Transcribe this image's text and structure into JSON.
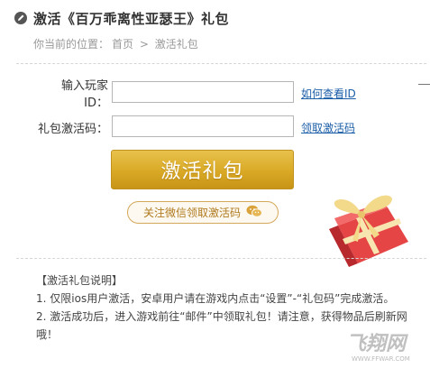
{
  "header": {
    "title": "激活《百万乖离性亚瑟王》礼包"
  },
  "breadcrumb": {
    "prefix": "你当前的位置：",
    "home": "首页",
    "separator": ">",
    "current": "激活礼包"
  },
  "form": {
    "player_id_label": "输入玩家ID：",
    "player_id_value": "",
    "player_id_link": "如何查看ID",
    "code_label": "礼包激活码：",
    "code_value": "",
    "code_link": "领取激活码",
    "activate_button": "激活礼包",
    "wechat_button": "关注微信领取激活码"
  },
  "instructions": {
    "heading": "【激活礼包说明】",
    "items": [
      "1. 仅限ios用户激活，安卓用户请在游戏内点击“设置”-“礼包码”完成激活。",
      "2. 激活成功后，进入游戏前往“邮件”中领取礼包！请注意，获得物品后刷新网哦！"
    ]
  },
  "watermark": {
    "text": "飞翔网",
    "url": "WWW.FFWAR.COM"
  },
  "colors": {
    "link": "#1b5ea8",
    "button_gold": "#d9a925",
    "wechat_text": "#b07a1f"
  },
  "icons": {
    "title": "pencil-circle-icon",
    "wechat": "wechat-icon",
    "gift": "gift-box-icon"
  }
}
